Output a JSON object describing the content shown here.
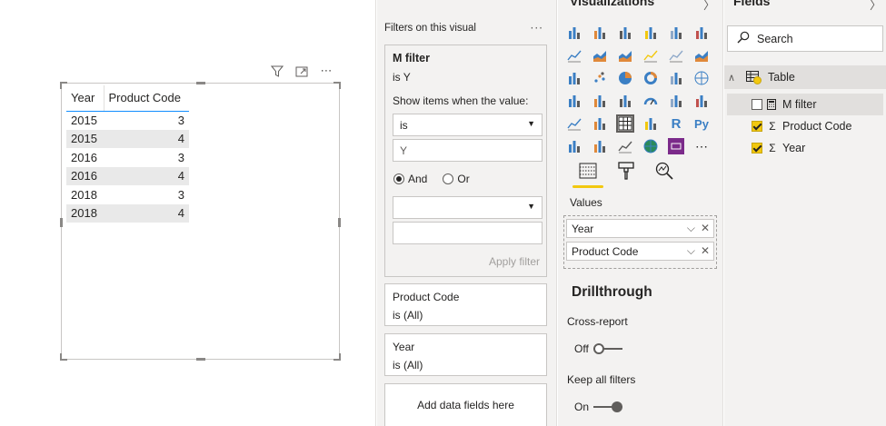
{
  "colors": {
    "accent_yellow": "#f2c80f",
    "header_underline": "#118dff",
    "pane_bg": "#f3f2f1",
    "row_alt": "#e9e9e9"
  },
  "canvas": {
    "header_icons": [
      "filter-icon",
      "focus-mode-icon",
      "more-options-icon"
    ],
    "more_glyph": "⋯",
    "table": {
      "columns": [
        "Year",
        "Product Code"
      ],
      "rows": [
        [
          "2015",
          "3"
        ],
        [
          "2015",
          "4"
        ],
        [
          "2016",
          "3"
        ],
        [
          "2016",
          "4"
        ],
        [
          "2018",
          "3"
        ],
        [
          "2018",
          "4"
        ]
      ]
    }
  },
  "filters": {
    "title": "Filters on this visual",
    "more_glyph": "···",
    "m_filter": {
      "name": "M filter",
      "state": "is Y",
      "hint": "Show items when the value:",
      "operator1": "is",
      "value1": "Y",
      "and_label": "And",
      "or_label": "Or",
      "operator2": "",
      "value2": "",
      "apply_label": "Apply filter"
    },
    "product_code": {
      "name": "Product Code",
      "state": "is (All)"
    },
    "year": {
      "name": "Year",
      "state": "is (All)"
    },
    "add_label": "Add data fields here"
  },
  "visualizations": {
    "title": "Visualizations",
    "collapse_glyph": "〉",
    "icons": [
      "stacked-bar-icon",
      "stacked-column-icon",
      "clustered-bar-icon",
      "clustered-column-icon",
      "100-stacked-bar-icon",
      "100-stacked-column-icon",
      "line-chart-icon",
      "area-chart-icon",
      "stacked-area-icon",
      "line-column-icon",
      "line-clustered-icon",
      "ribbon-chart-icon",
      "waterfall-icon",
      "scatter-icon",
      "pie-icon",
      "donut-icon",
      "treemap-icon",
      "map-icon",
      "filled-map-icon",
      "shape-map-icon",
      "funnel-icon",
      "gauge-icon",
      "card-icon",
      "multirow-card-icon",
      "kpi-icon",
      "slicer-icon",
      "table-icon",
      "matrix-icon",
      "r-visual-icon",
      "python-visual-icon",
      "key-influencers-icon",
      "decomposition-tree-icon",
      "qna-icon",
      "arcgis-icon",
      "smart-narrative-icon",
      "more-visuals-icon"
    ],
    "r_glyph": "R",
    "py_glyph": "Py",
    "more_glyph": "⋯",
    "values_label": "Values",
    "wells": [
      {
        "label": "Year"
      },
      {
        "label": "Product Code"
      }
    ],
    "chevron_glyph": "⌵",
    "remove_glyph": "✕",
    "drillthrough": "Drillthrough",
    "cross_report_label": "Cross-report",
    "cross_report_state": "Off",
    "keep_filters_label": "Keep all filters",
    "keep_filters_state": "On"
  },
  "fields": {
    "title": "Fields",
    "collapse_glyph": "〉",
    "search_placeholder": "Search",
    "table_name": "Table",
    "expand_glyph": "∧",
    "items": [
      {
        "name": "M filter",
        "checked": false,
        "type": "calculator-icon"
      },
      {
        "name": "Product Code",
        "checked": true,
        "type": "sigma-icon"
      },
      {
        "name": "Year",
        "checked": true,
        "type": "sigma-icon"
      }
    ],
    "sigma_glyph": "Σ"
  }
}
